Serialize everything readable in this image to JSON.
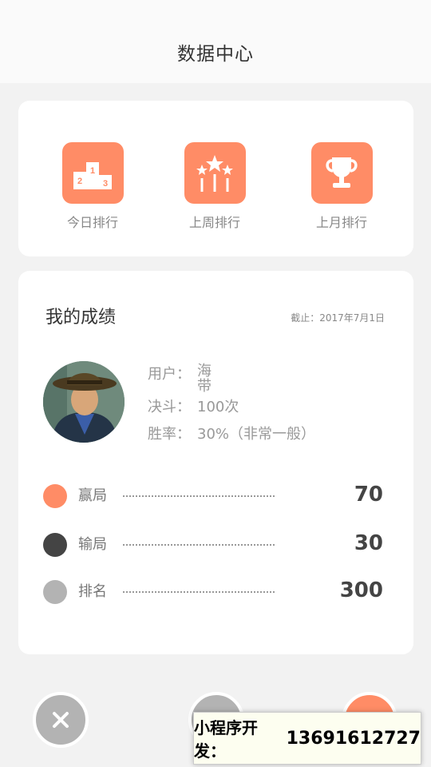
{
  "header": {
    "title": "数据中心"
  },
  "rankings": [
    {
      "label": "今日排行",
      "icon": "podium-icon"
    },
    {
      "label": "上周排行",
      "icon": "stars-icon"
    },
    {
      "label": "上月排行",
      "icon": "trophy-icon"
    }
  ],
  "score": {
    "title": "我的成绩",
    "date": "截止：2017年7月1日",
    "user": {
      "name_key": "用户：",
      "name": "海带",
      "battles_key": "决斗：",
      "battles": "100次",
      "winrate_key": "胜率：",
      "winrate": "30%（非常一般）"
    },
    "stats": [
      {
        "label": "赢局",
        "value": "70",
        "color": "#ff8c66"
      },
      {
        "label": "输局",
        "value": "30",
        "color": "#444444"
      },
      {
        "label": "排名",
        "value": "300",
        "color": "#b3b3b3"
      }
    ]
  },
  "watermark": {
    "label": "小程序开发：",
    "number": "13691612727"
  },
  "colors": {
    "accent": "#ff8c66",
    "dark": "#444444",
    "grey": "#b3b3b3"
  }
}
